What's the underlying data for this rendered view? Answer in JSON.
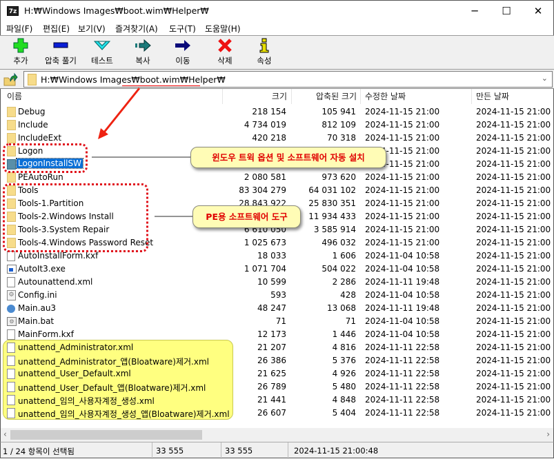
{
  "window": {
    "title": "H:₩Windows Images₩boot.wim₩Helper₩",
    "app_icon": "7z",
    "minimize": "─",
    "maximize": "☐",
    "close": "✕"
  },
  "menu": [
    "파일(F)",
    "편집(E)",
    "보기(V)",
    "즐겨찾기(A)",
    "도구(T)",
    "도움말(H)"
  ],
  "toolbar": [
    {
      "label": "추가",
      "icon": "add-icon",
      "color": "#22dd22"
    },
    {
      "label": "압축 풀기",
      "icon": "extract-icon",
      "color": "#0a1ed6"
    },
    {
      "label": "테스트",
      "icon": "test-icon",
      "color": "#22e0e8"
    },
    {
      "label": "복사",
      "icon": "copy-icon",
      "color": "#1a7a7a"
    },
    {
      "label": "이동",
      "icon": "move-icon",
      "color": "#0a0a7a"
    },
    {
      "label": "삭제",
      "icon": "delete-icon",
      "color": "#ee1111"
    },
    {
      "label": "속성",
      "icon": "info-icon",
      "color": "#e8e000"
    }
  ],
  "address": {
    "path": "H:₩Windows Images₩boot.wim₩Helper₩"
  },
  "columns": {
    "name": "이름",
    "size": "크기",
    "packed": "압축된 크기",
    "modified": "수정한 날짜",
    "created": "만든 날짜"
  },
  "files": [
    {
      "name": "Debug",
      "type": "folder",
      "size": "218 154",
      "packed": "105 941",
      "modified": "2024-11-15 21:00",
      "created": "2024-11-15 21:00"
    },
    {
      "name": "Include",
      "type": "folder",
      "size": "4 734 019",
      "packed": "812 109",
      "modified": "2024-11-15 21:00",
      "created": "2024-11-15 21:00"
    },
    {
      "name": "IncludeExt",
      "type": "folder",
      "size": "420 218",
      "packed": "70 318",
      "modified": "2024-11-15 21:00",
      "created": "2024-11-15 21:00"
    },
    {
      "name": "Logon",
      "type": "folder",
      "size": "",
      "packed": "",
      "modified": "2024-11-15 21:00",
      "created": "2024-11-15 21:00"
    },
    {
      "name": "LogonInstallSW",
      "type": "folder",
      "size": "",
      "packed": "",
      "modified": "2024-11-15 21:00",
      "created": "2024-11-15 21:00",
      "selected": true
    },
    {
      "name": "PEAutoRun",
      "type": "folder",
      "size": "2 080 581",
      "packed": "973 620",
      "modified": "2024-11-15 21:00",
      "created": "2024-11-15 21:00"
    },
    {
      "name": "Tools",
      "type": "folder",
      "size": "83 304 279",
      "packed": "64 031 102",
      "modified": "2024-11-15 21:00",
      "created": "2024-11-15 21:00"
    },
    {
      "name": "Tools-1.Partition",
      "type": "folder",
      "size": "28 843 922",
      "packed": "25 830 351",
      "modified": "2024-11-15 21:00",
      "created": "2024-11-15 21:00"
    },
    {
      "name": "Tools-2.Windows Install",
      "type": "folder",
      "size": "",
      "packed": "11 934 433",
      "modified": "2024-11-15 21:00",
      "created": "2024-11-15 21:00"
    },
    {
      "name": "Tools-3.System Repair",
      "type": "folder",
      "size": "6 610 050",
      "packed": "3 585 914",
      "modified": "2024-11-15 21:00",
      "created": "2024-11-15 21:00"
    },
    {
      "name": "Tools-4.Windows Password Reset",
      "type": "folder",
      "size": "1 025 673",
      "packed": "496 032",
      "modified": "2024-11-15 21:00",
      "created": "2024-11-15 21:00"
    },
    {
      "name": "AutoInstallForm.kxf",
      "type": "file",
      "size": "18 033",
      "packed": "1 606",
      "modified": "2024-11-04 10:58",
      "created": "2024-11-15 21:00"
    },
    {
      "name": "AutoIt3.exe",
      "type": "exe",
      "size": "1 071 704",
      "packed": "504 022",
      "modified": "2024-11-04 10:58",
      "created": "2024-11-15 21:00"
    },
    {
      "name": "Autounattend.xml",
      "type": "file",
      "size": "10 599",
      "packed": "2 286",
      "modified": "2024-11-11 19:48",
      "created": "2024-11-15 21:00"
    },
    {
      "name": "Config.ini",
      "type": "ini",
      "size": "593",
      "packed": "428",
      "modified": "2024-11-04 10:58",
      "created": "2024-11-15 21:00"
    },
    {
      "name": "Main.au3",
      "type": "au3",
      "size": "48 247",
      "packed": "13 068",
      "modified": "2024-11-11 19:48",
      "created": "2024-11-15 21:00"
    },
    {
      "name": "Main.bat",
      "type": "bat",
      "size": "71",
      "packed": "71",
      "modified": "2024-11-04 10:58",
      "created": "2024-11-15 21:00"
    },
    {
      "name": "MainForm.kxf",
      "type": "file",
      "size": "12 173",
      "packed": "1 446",
      "modified": "2024-11-04 10:58",
      "created": "2024-11-15 21:00"
    },
    {
      "name": "unattend_Administrator.xml",
      "type": "file",
      "size": "21 207",
      "packed": "4 816",
      "modified": "2024-11-11 22:58",
      "created": "2024-11-15 21:00"
    },
    {
      "name": "unattend_Administrator_앱(Bloatware)제거.xml",
      "type": "file",
      "size": "26 386",
      "packed": "5 376",
      "modified": "2024-11-11 22:58",
      "created": "2024-11-15 21:00"
    },
    {
      "name": "unattend_User_Default.xml",
      "type": "file",
      "size": "21 625",
      "packed": "4 926",
      "modified": "2024-11-11 22:58",
      "created": "2024-11-15 21:00"
    },
    {
      "name": "unattend_User_Default_앱(Bloatware)제거.xml",
      "type": "file",
      "size": "26 789",
      "packed": "5 480",
      "modified": "2024-11-11 22:58",
      "created": "2024-11-15 21:00"
    },
    {
      "name": "unattend_임의_사용자계정_생성.xml",
      "type": "file",
      "size": "21 441",
      "packed": "4 848",
      "modified": "2024-11-11 22:58",
      "created": "2024-11-15 21:00"
    },
    {
      "name": "unattend_임의_사용자계정_생성_앱(Bloatware)제거.xml",
      "type": "file",
      "size": "26 607",
      "packed": "5 404",
      "modified": "2024-11-11 22:58",
      "created": "2024-11-15 21:00"
    }
  ],
  "status": {
    "selection": "1 / 24 항목이 선택됨",
    "size": "33 555",
    "packed": "33 555",
    "modified": "2024-11-15 21:00:48"
  },
  "annotations": {
    "callout1": "윈도우 트윅 옵션 및 소프트웨어 자동 설치",
    "callout2": "PE용 소프트웨어 도구",
    "highlight_color": "#ffff80",
    "marker_color": "#e0101a"
  }
}
